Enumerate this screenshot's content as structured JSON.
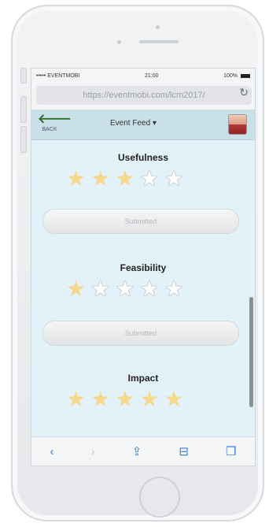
{
  "status": {
    "carrier": "••••• EVENTMOBI",
    "time": "21:00",
    "battery": "100%"
  },
  "browser": {
    "url": "https://eventmobi.com/lcm2017/"
  },
  "appbar": {
    "back_label": "BACK",
    "title": "Event Feed ▾"
  },
  "sections": [
    {
      "title": "Usefulness",
      "rating": 3,
      "max": 5,
      "button": "Submitted"
    },
    {
      "title": "Feasibility",
      "rating": 1,
      "max": 5,
      "button": "Submitted"
    },
    {
      "title": "Impact",
      "rating": 5,
      "max": 5,
      "button": ""
    }
  ],
  "icons": {
    "back": "arrow-left-icon",
    "reload": "reload-icon",
    "toolbar": [
      "back-icon",
      "forward-icon",
      "share-icon",
      "bookmarks-icon",
      "tabs-icon"
    ]
  },
  "colors": {
    "star_filled": "#f4d88c",
    "app_bg": "#e3f2f8",
    "appbar_bg": "#c9e0e8"
  }
}
